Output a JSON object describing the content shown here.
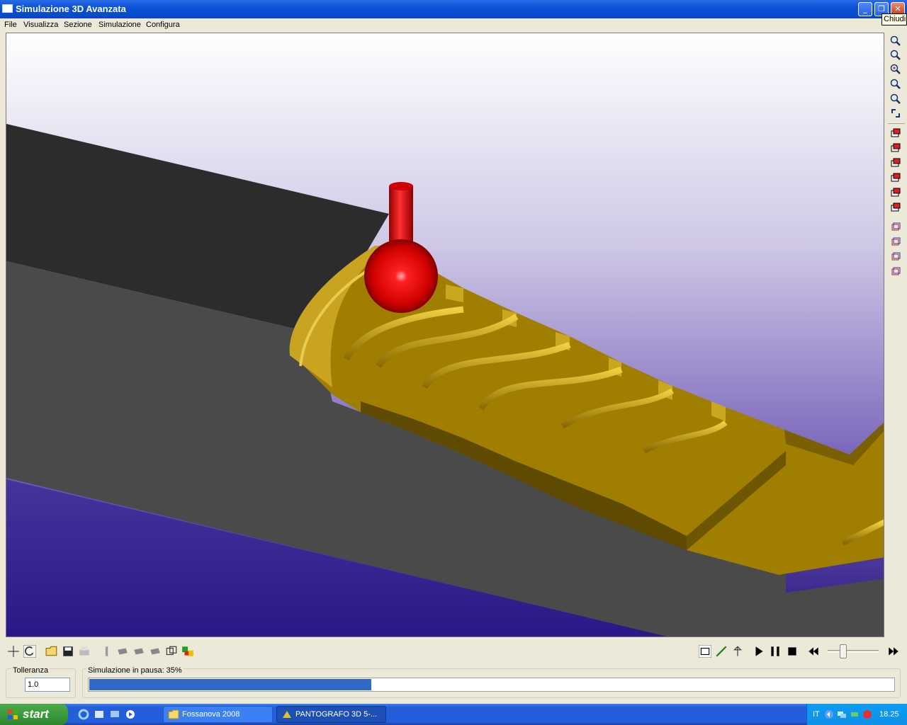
{
  "window": {
    "title": "Simulazione 3D Avanzata",
    "tooltip": "Chiudi"
  },
  "menu": [
    "File",
    "Visualizza",
    "Sezione",
    "Simulazione",
    "Configura"
  ],
  "right_toolbar_icons": [
    "zoom-icon",
    "zoom-window-icon",
    "zoom-in-icon",
    "zoom-out-icon",
    "zoom-extents-icon",
    "rotate-view-icon",
    "view-front-icon",
    "view-top-icon",
    "view-right-icon",
    "view-back-icon",
    "view-left-icon",
    "view-bottom-icon",
    "iso-view-1-icon",
    "iso-view-2-icon",
    "iso-view-3-icon",
    "iso-view-4-icon"
  ],
  "bottom_toolbar_icons": [
    "pan-icon",
    "rotate-icon",
    "open-icon",
    "save-icon",
    "print-icon",
    "tool-icon",
    "shade-1-icon",
    "shade-2-icon",
    "shade-3-icon",
    "wireframe-icon",
    "colors-icon"
  ],
  "playback_icons": [
    "options-icon",
    "path-icon",
    "axis-icon",
    "play-icon",
    "pause-icon",
    "stop-icon",
    "rewind-icon",
    "speed-slider",
    "fast-forward-icon"
  ],
  "speed_level": 0.28,
  "tolleranza": {
    "label": "Tolleranza",
    "value": "1.0"
  },
  "simulation": {
    "status": "Simulazione in pausa: 35%",
    "progress": 0.35
  },
  "taskbar": {
    "start": "start",
    "tasks": [
      "Fossanova 2008",
      "PANTOGRAFO 3D 5-..."
    ],
    "tray": {
      "language": "IT",
      "clock": "18.25"
    }
  },
  "colors": {
    "tool": "#e00000",
    "material": "#a07e00",
    "stock_top": "#2c2c2c",
    "stock_side": "#4a4a4a",
    "sky_top": "#ffffff",
    "sky_bottom": "#6a56b0",
    "floor": "#3a2a8e"
  }
}
